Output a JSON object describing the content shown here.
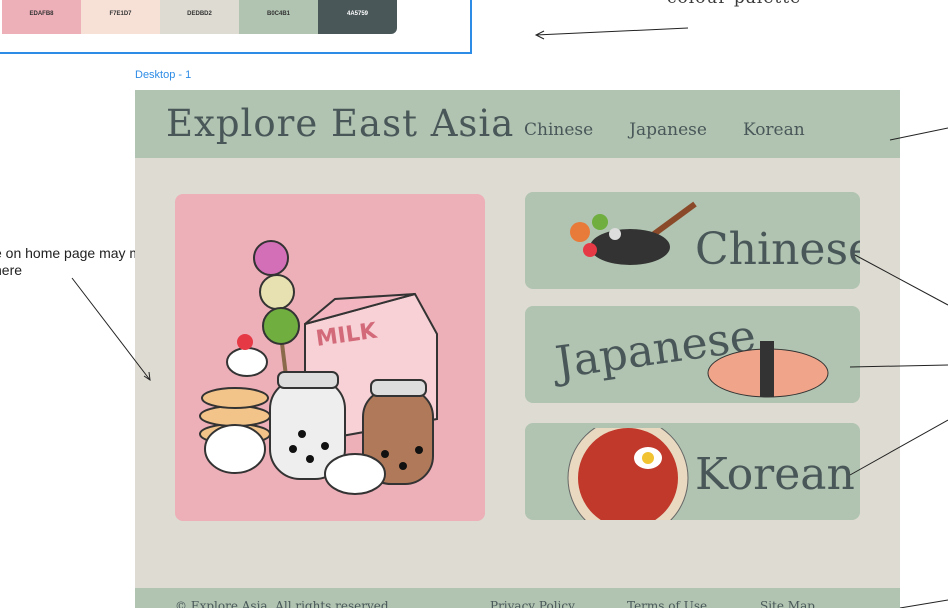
{
  "palette": {
    "caption": "colour palette",
    "swatches": [
      {
        "hex": "EDAFB8",
        "color": "#edafb8"
      },
      {
        "hex": "F7E1D7",
        "color": "#f7e1d7"
      },
      {
        "hex": "DEDBD2",
        "color": "#dedbd2"
      },
      {
        "hex": "B0C4B1",
        "color": "#b0c4b1"
      },
      {
        "hex": "4A5759",
        "color": "#4a5759"
      }
    ]
  },
  "frame_label": "Desktop - 1",
  "annotation": "e on home page may move\nhere",
  "site": {
    "title": "Explore East Asia",
    "nav": [
      "Chinese",
      "Japanese",
      "Korean"
    ],
    "cards": [
      "Chinese",
      "Japanese",
      "Korean"
    ],
    "footer": [
      "Explore Asia. All rights reserved.",
      "Privacy Policy",
      "Terms of Use",
      "Site Map"
    ]
  }
}
